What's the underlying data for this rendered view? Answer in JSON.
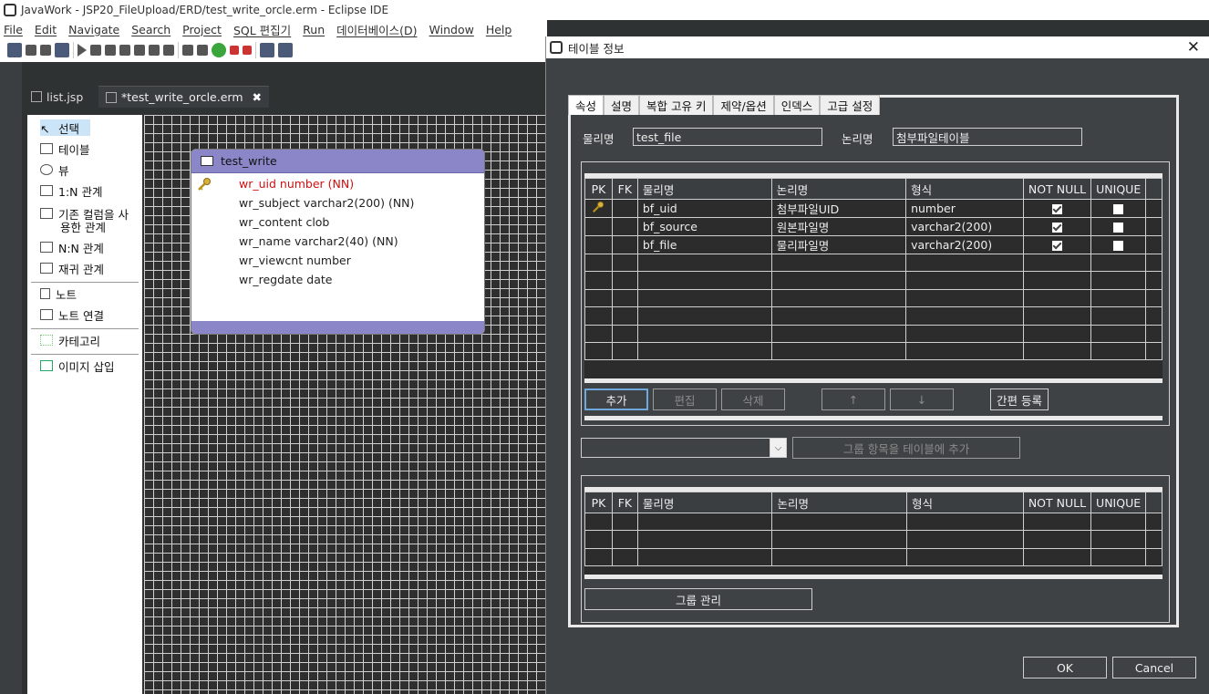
{
  "window": {
    "title": "JavaWork - JSP20_FileUpload/ERD/test_write_orcle.erm - Eclipse IDE"
  },
  "menu": [
    "File",
    "Edit",
    "Navigate",
    "Search",
    "Project",
    "SQL 편집기",
    "Run",
    "데이터베이스(D)",
    "Window",
    "Help"
  ],
  "editor_tabs": [
    {
      "label": "list.jsp"
    },
    {
      "label": "*test_write_orcle.erm",
      "close": "✖"
    }
  ],
  "palette": {
    "items": [
      {
        "label": "선택"
      },
      {
        "label": "테이블"
      },
      {
        "label": "뷰"
      },
      {
        "label": "1:N 관계"
      },
      {
        "label": "기존 컬럼을 사"
      },
      {
        "label": "용한 관계"
      },
      {
        "label": "N:N 관계"
      },
      {
        "label": "재귀 관계"
      },
      {
        "label": "노트"
      },
      {
        "label": "노트 연결"
      },
      {
        "label": "카테고리"
      },
      {
        "label": "이미지 삽입"
      }
    ]
  },
  "entity": {
    "name": "test_write",
    "columns": [
      "wr_uid number (NN)",
      "wr_subject varchar2(200) (NN)",
      "wr_content clob",
      "wr_name varchar2(40) (NN)",
      "wr_viewcnt number",
      "wr_regdate date"
    ]
  },
  "dialog": {
    "title": "테이블 정보",
    "close": "✕",
    "tabs": [
      "속성",
      "설명",
      "복합 고유 키",
      "제약/옵션",
      "인덱스",
      "고급 설정"
    ],
    "physical_label": "물리명",
    "physical_value": "test_file",
    "logical_label": "논리명",
    "logical_value": "첨부파일테이블",
    "headers": [
      "PK",
      "FK",
      "물리명",
      "논리명",
      "형식",
      "NOT NULL",
      "UNIQUE"
    ],
    "rows": [
      {
        "pk": true,
        "physical": "bf_uid",
        "logical": "첨부파일UID",
        "type": "number",
        "notnull": true,
        "unique": false
      },
      {
        "pk": false,
        "physical": "bf_source",
        "logical": "원본파일명",
        "type": "varchar2(200)",
        "notnull": true,
        "unique": false
      },
      {
        "pk": false,
        "physical": "bf_file",
        "logical": "물리파일명",
        "type": "varchar2(200)",
        "notnull": true,
        "unique": false
      }
    ],
    "buttons": {
      "add": "추가",
      "edit": "편집",
      "delete": "삭제",
      "up": "↑",
      "down": "↓",
      "quick_register": "간편 등록",
      "add_group": "그룹 항목을 테이블에 추가",
      "group_manage": "그룹 관리",
      "ok": "OK",
      "cancel": "Cancel"
    }
  }
}
